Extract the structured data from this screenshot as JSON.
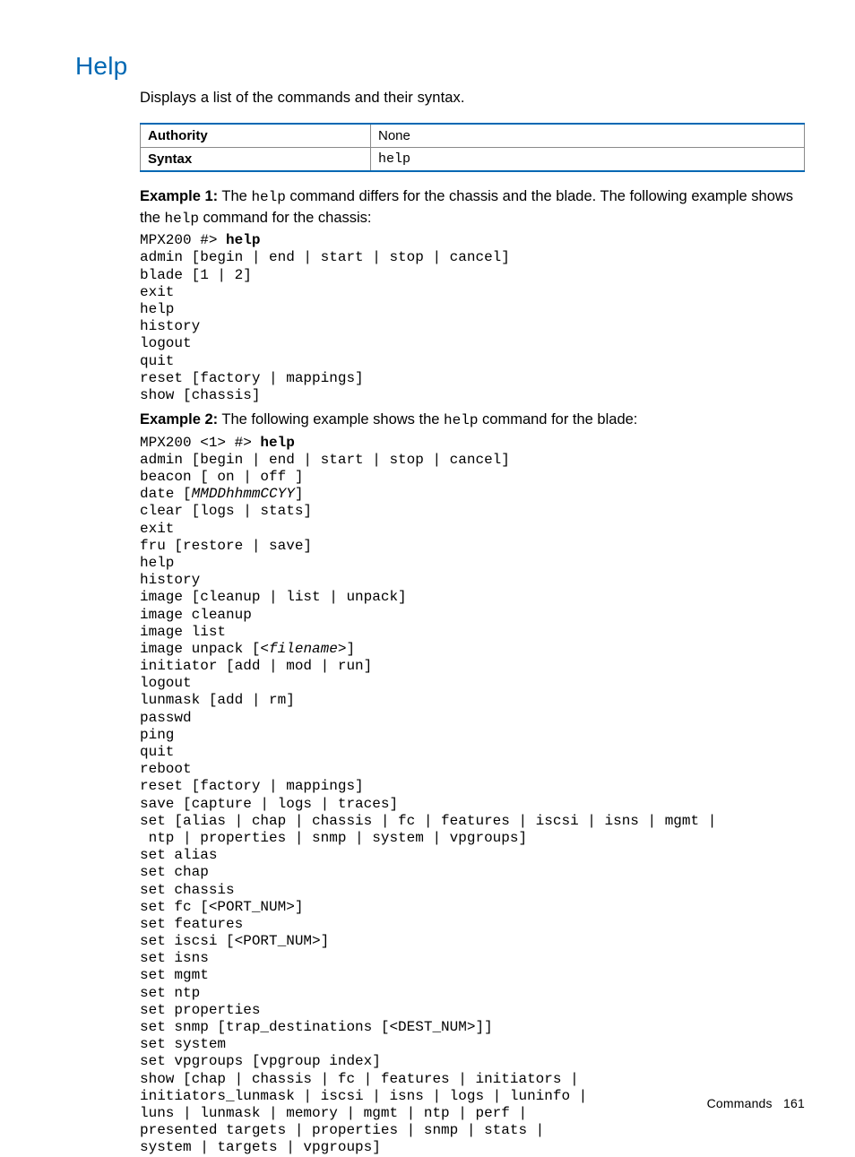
{
  "heading": "Help",
  "lead": "Displays a list of the commands and their syntax.",
  "table": {
    "rows": [
      {
        "label": "Authority",
        "value": "None",
        "mono": false
      },
      {
        "label": "Syntax",
        "value": "help",
        "mono": true
      }
    ]
  },
  "example1": {
    "label": "Example 1:",
    "text_parts": [
      {
        "t": " The ",
        "cls": ""
      },
      {
        "t": "help",
        "cls": "mono-inline"
      },
      {
        "t": " command differs for the chassis and the blade. The following example shows the ",
        "cls": ""
      },
      {
        "t": "help",
        "cls": "mono-inline"
      },
      {
        "t": " command for the chassis:",
        "cls": ""
      }
    ],
    "code_lines": [
      [
        {
          "t": "MPX200 #> "
        },
        {
          "t": "help",
          "cls": "b"
        }
      ],
      [
        {
          "t": "admin [begin | end | start | stop | cancel]"
        }
      ],
      [
        {
          "t": "blade [1 | 2]"
        }
      ],
      [
        {
          "t": "exit"
        }
      ],
      [
        {
          "t": "help"
        }
      ],
      [
        {
          "t": "history"
        }
      ],
      [
        {
          "t": "logout"
        }
      ],
      [
        {
          "t": "quit"
        }
      ],
      [
        {
          "t": "reset [factory | mappings]"
        }
      ],
      [
        {
          "t": "show [chassis]"
        }
      ]
    ]
  },
  "example2": {
    "label": "Example 2:",
    "text_parts": [
      {
        "t": " The following example shows the ",
        "cls": ""
      },
      {
        "t": "help",
        "cls": "mono-inline"
      },
      {
        "t": " command for the blade:",
        "cls": ""
      }
    ],
    "code_lines": [
      [
        {
          "t": "MPX200 <1> #> "
        },
        {
          "t": "help",
          "cls": "b"
        }
      ],
      [
        {
          "t": "admin [begin | end | start | stop | cancel]"
        }
      ],
      [
        {
          "t": "beacon [ on | off ]"
        }
      ],
      [
        {
          "t": "date ["
        },
        {
          "t": "MMDDhhmmCCYY",
          "cls": "i"
        },
        {
          "t": "]"
        }
      ],
      [
        {
          "t": "clear [logs | stats]"
        }
      ],
      [
        {
          "t": "exit"
        }
      ],
      [
        {
          "t": "fru [restore | save]"
        }
      ],
      [
        {
          "t": "help"
        }
      ],
      [
        {
          "t": "history"
        }
      ],
      [
        {
          "t": "image [cleanup | list | unpack]"
        }
      ],
      [
        {
          "t": "image cleanup"
        }
      ],
      [
        {
          "t": "image list"
        }
      ],
      [
        {
          "t": "image unpack [<"
        },
        {
          "t": "filename",
          "cls": "i"
        },
        {
          "t": ">]"
        }
      ],
      [
        {
          "t": "initiator [add | mod | run]"
        }
      ],
      [
        {
          "t": "logout"
        }
      ],
      [
        {
          "t": "lunmask [add | rm]"
        }
      ],
      [
        {
          "t": "passwd"
        }
      ],
      [
        {
          "t": "ping"
        }
      ],
      [
        {
          "t": "quit"
        }
      ],
      [
        {
          "t": "reboot"
        }
      ],
      [
        {
          "t": "reset [factory | mappings]"
        }
      ],
      [
        {
          "t": "save [capture | logs | traces]"
        }
      ],
      [
        {
          "t": "set [alias | chap | chassis | fc | features | iscsi | isns | mgmt |"
        }
      ],
      [
        {
          "t": " ntp | properties | snmp | system | vpgroups]"
        }
      ],
      [
        {
          "t": "set alias"
        }
      ],
      [
        {
          "t": "set chap"
        }
      ],
      [
        {
          "t": "set chassis"
        }
      ],
      [
        {
          "t": "set fc [<PORT_NUM>]"
        }
      ],
      [
        {
          "t": "set features"
        }
      ],
      [
        {
          "t": "set iscsi [<PORT_NUM>]"
        }
      ],
      [
        {
          "t": "set isns"
        }
      ],
      [
        {
          "t": "set mgmt"
        }
      ],
      [
        {
          "t": "set ntp"
        }
      ],
      [
        {
          "t": "set properties"
        }
      ],
      [
        {
          "t": "set snmp [trap_destinations [<DEST_NUM>]]"
        }
      ],
      [
        {
          "t": "set system"
        }
      ],
      [
        {
          "t": "set vpgroups [vpgroup index]"
        }
      ],
      [
        {
          "t": "show [chap | chassis | fc | features | initiators |"
        }
      ],
      [
        {
          "t": "initiators_lunmask | iscsi | isns | logs | luninfo |"
        }
      ],
      [
        {
          "t": "luns | lunmask | memory | mgmt | ntp | perf |"
        }
      ],
      [
        {
          "t": "presented targets | properties | snmp | stats |"
        }
      ],
      [
        {
          "t": "system | targets | vpgroups]"
        }
      ]
    ]
  },
  "footer": {
    "section": "Commands",
    "page": "161"
  }
}
